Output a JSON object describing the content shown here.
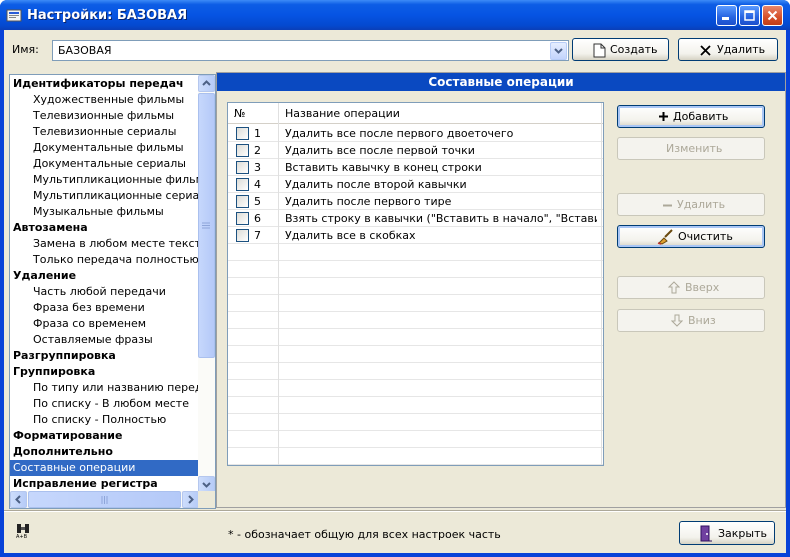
{
  "window": {
    "title": "Настройки: БАЗОВАЯ",
    "accent": "#0842d8"
  },
  "name_row": {
    "label": "Имя:",
    "value": "БАЗОВАЯ",
    "create_label": "Создать",
    "delete_label": "Удалить"
  },
  "tree": {
    "items": [
      {
        "label": "Идентификаторы передач",
        "group": true
      },
      {
        "label": "Художественные фильмы",
        "group": false
      },
      {
        "label": "Телевизионные фильмы",
        "group": false
      },
      {
        "label": "Телевизионные сериалы",
        "group": false
      },
      {
        "label": "Документальные фильмы",
        "group": false
      },
      {
        "label": "Документальные сериалы",
        "group": false
      },
      {
        "label": "Мультипликационные фильмы",
        "group": false
      },
      {
        "label": "Мультипликационные сериалы",
        "group": false
      },
      {
        "label": "Музыкальные фильмы",
        "group": false
      },
      {
        "label": "Автозамена",
        "group": true
      },
      {
        "label": "Замена в любом месте текста",
        "group": false
      },
      {
        "label": "Только передача полностью",
        "group": false
      },
      {
        "label": "Удаление",
        "group": true
      },
      {
        "label": "Часть любой передачи",
        "group": false
      },
      {
        "label": "Фраза без времени",
        "group": false
      },
      {
        "label": "Фраза со временем",
        "group": false
      },
      {
        "label": "Оставляемые фразы",
        "group": false
      },
      {
        "label": "Разгруппировка",
        "group": true
      },
      {
        "label": "Группировка",
        "group": true
      },
      {
        "label": "По типу или названию передачи",
        "group": false
      },
      {
        "label": "По списку - В любом месте",
        "group": false
      },
      {
        "label": "По списку - Полностью",
        "group": false
      },
      {
        "label": "Форматирование",
        "group": true
      },
      {
        "label": "Дополнительно",
        "group": true
      },
      {
        "label": "Составные операции",
        "group": false,
        "selected": true
      },
      {
        "label": "Исправление регистра",
        "group": true
      }
    ]
  },
  "panel": {
    "title": "Составные операции"
  },
  "grid": {
    "col_num": "№",
    "col_name": "Название операции",
    "rows": [
      {
        "num": "1",
        "name": "Удалить все после первого двоеточего"
      },
      {
        "num": "2",
        "name": "Удалить все после первой точки"
      },
      {
        "num": "3",
        "name": "Вставить кавычку в конец строки"
      },
      {
        "num": "4",
        "name": "Удалить после второй кавычки"
      },
      {
        "num": "5",
        "name": "Удалить после первого тире"
      },
      {
        "num": "6",
        "name": "Взять строку в кавычки (\"Вставить в начало\", \"Вставить в ..."
      },
      {
        "num": "7",
        "name": "Удалить все в скобках"
      }
    ]
  },
  "actions": {
    "add": "Добавить",
    "edit": "Изменить",
    "remove": "Удалить",
    "clear": "Очистить",
    "up": "Вверх",
    "down": "Вниз"
  },
  "footer": {
    "note": "* - обозначает общую для всех настроек часть",
    "close": "Закрыть"
  }
}
